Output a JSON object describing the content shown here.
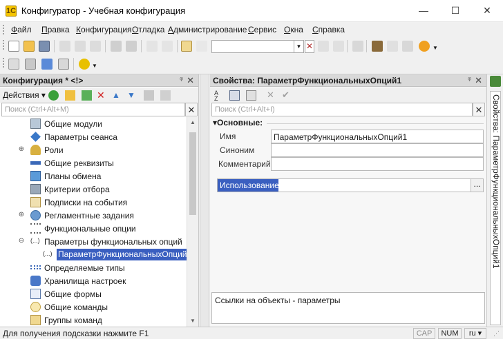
{
  "window": {
    "title": "Конфигуратор - Учебная конфигурация",
    "minimize": "—",
    "maximize": "☐",
    "close": "✕"
  },
  "menu": {
    "items": [
      {
        "label": "Файл",
        "u": "Ф",
        "rest": "айл"
      },
      {
        "label": "Правка",
        "u": "П",
        "rest": "равка"
      },
      {
        "label": "Конфигурация",
        "u": "К",
        "rest": "онфигурация"
      },
      {
        "label": "Отладка",
        "u": "О",
        "rest": "тладка"
      },
      {
        "label": "Администрирование",
        "u": "А",
        "rest": "дминистрирование"
      },
      {
        "label": "Сервис",
        "u": "С",
        "rest": "ервис"
      },
      {
        "label": "Окна",
        "u": "О",
        "rest": "кна"
      },
      {
        "label": "Справка",
        "u": "С",
        "rest": "правка"
      }
    ]
  },
  "left_panel": {
    "title": "Конфигурация * <!>",
    "pin": "ᵠ",
    "close": "✕",
    "actions_label": "Действия ▾",
    "search_placeholder": "Поиск (Ctrl+Alt+M)",
    "search_clear": "✕",
    "tree": [
      {
        "label": "Общие модули",
        "icon": "module-icon",
        "expander": "",
        "selected": false
      },
      {
        "label": "Параметры сеанса",
        "icon": "session-param-icon",
        "expander": "",
        "selected": false
      },
      {
        "label": "Роли",
        "icon": "role-icon",
        "expander": "⊕",
        "selected": false
      },
      {
        "label": "Общие реквизиты",
        "icon": "common-attr-icon",
        "expander": "",
        "selected": false
      },
      {
        "label": "Планы обмена",
        "icon": "exchange-plan-icon",
        "expander": "",
        "selected": false
      },
      {
        "label": "Критерии отбора",
        "icon": "filter-criteria-icon",
        "expander": "",
        "selected": false
      },
      {
        "label": "Подписки на события",
        "icon": "event-subscription-icon",
        "expander": "",
        "selected": false
      },
      {
        "label": "Регламентные задания",
        "icon": "scheduled-job-icon",
        "expander": "⊕",
        "selected": false
      },
      {
        "label": "Функциональные опции",
        "icon": "functional-option-icon",
        "expander": "",
        "selected": false
      },
      {
        "label": "Параметры функциональных опций",
        "icon": "fo-param-group-icon",
        "expander": "⊖",
        "selected": false
      },
      {
        "label": "ПараметрФункциональныхОпций1",
        "icon": "fo-param-icon",
        "expander": "",
        "selected": true
      },
      {
        "label": "Определяемые типы",
        "icon": "defined-type-icon",
        "expander": "",
        "selected": false
      },
      {
        "label": "Хранилища настроек",
        "icon": "settings-storage-icon",
        "expander": "",
        "selected": false
      },
      {
        "label": "Общие формы",
        "icon": "common-form-icon",
        "expander": "",
        "selected": false
      },
      {
        "label": "Общие команды",
        "icon": "common-command-icon",
        "expander": "",
        "selected": false
      },
      {
        "label": "Группы команд",
        "icon": "command-group-icon",
        "expander": "",
        "selected": false
      }
    ],
    "scroll_up": "▲",
    "scroll_down": "▼"
  },
  "right_panel": {
    "title": "Свойства: ПараметрФункциональныхОпций1",
    "pin": "ᵠ",
    "close": "✕",
    "search_placeholder": "Поиск (Ctrl+Alt+I)",
    "search_clear": "✕",
    "section_title": "▾Основные:",
    "fields": {
      "name_label": "Имя",
      "name_value": "ПараметрФункциональныхОпций1",
      "synonym_label": "Синоним",
      "synonym_value": "",
      "comment_label": "Комментарий",
      "comment_value": ""
    },
    "usage_label": "Использование",
    "usage_button": "...",
    "links_text": "Ссылки на объекты - параметры"
  },
  "side_tab": {
    "label": "Свойства: ПараметрФункциональныхОпций1"
  },
  "status": {
    "hint": "Для получения подсказки нажмите F1",
    "cap": "CAP",
    "num": "NUM",
    "lang": "ru ▾",
    "grip": "⋰"
  },
  "colors": {
    "selection": "#3a5fc0",
    "panel_header": "#d9d9d9",
    "app_icon": "#f5c400"
  }
}
